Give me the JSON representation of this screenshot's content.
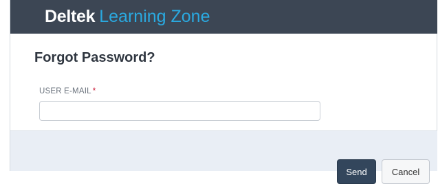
{
  "header": {
    "brand": "Deltek",
    "product": "Learning Zone"
  },
  "form": {
    "title": "Forgot Password?",
    "email_label": "USER E-MAIL",
    "required_marker": "*",
    "email_value": "",
    "email_placeholder": ""
  },
  "footer": {
    "send_label": "Send",
    "cancel_label": "Cancel"
  },
  "colors": {
    "header_bg": "#3c4654",
    "brand_text": "#ffffff",
    "product_text": "#2aa9e0",
    "footer_bg": "#e9eef5",
    "primary_button": "#33465c",
    "required": "#c8102e"
  }
}
